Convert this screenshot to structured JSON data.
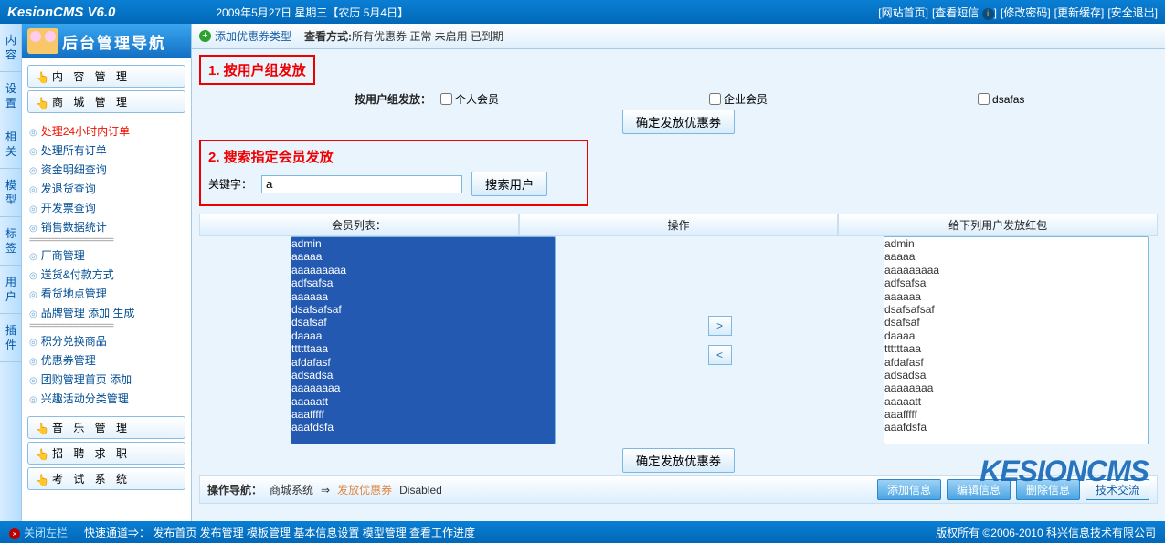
{
  "top": {
    "brand": "KesionCMS V6.0",
    "date": "2009年5月27日 星期三【农历 5月4日】",
    "links": {
      "home": "[网站首页]",
      "sms": "[查看短信",
      "sms2": "]",
      "pwd": "[修改密码]",
      "cache": "[更新缓存]",
      "exit": "[安全退出]"
    }
  },
  "rails": [
    "内容",
    "设置",
    "相关",
    "模型",
    "标签",
    "用户",
    "插件"
  ],
  "navhead": "后台管理导航",
  "navbtns": {
    "content": "内 容 管 理",
    "mall": "商 城 管 理",
    "music": "音 乐 管 理",
    "job": "招 聘 求 职",
    "exam": "考 试 系 统"
  },
  "navitems": [
    "处理24小时内订单",
    "处理所有订单",
    "资金明细查询",
    "发退货查询",
    "开发票查询",
    "销售数据统计"
  ],
  "navitems2": [
    "厂商管理",
    "送货&付款方式",
    "看货地点管理",
    "品牌管理 添加 生成"
  ],
  "navitems3": [
    "积分兑换商品",
    "优惠券管理",
    "团购管理首页 添加",
    "兴趣活动分类管理"
  ],
  "toolbar": {
    "add": "添加优惠券类型",
    "viewlabel": "查看方式:",
    "views": "所有优惠券 正常 未启用 已到期"
  },
  "annot1": "1. 按用户组发放",
  "annot2": "2. 搜索指定会员发放",
  "grouplabel": "按用户组发放：",
  "groups": {
    "g1": "个人会员",
    "g2": "企业会员",
    "g3": "dsafas"
  },
  "confirmBtn": "确定发放优惠券",
  "kwlabel": "关键字：",
  "kwvalue": "a",
  "searchBtn": "搜索用户",
  "colheads": {
    "left": "会员列表：",
    "mid": "操作",
    "right": "给下列用户发放红包"
  },
  "members": [
    "admin",
    "aaaaa",
    "aaaaaaaaa",
    "adfsafsa",
    "aaaaaa",
    "dsafsafsaf",
    "dsafsaf",
    "daaaa",
    "ttttttaaa",
    "afdafasf",
    "adsadsa",
    "aaaaaaaa",
    "aaaaatt",
    "aaafffff",
    "aaafdsfa"
  ],
  "ops": {
    "label": "操作导航：",
    "path": "商城系统",
    "arrow": " ⇒ ",
    "cur": "发放优惠券",
    "dis": " Disabled",
    "b1": "添加信息",
    "b2": "编辑信息",
    "b3": "删除信息",
    "b4": "技术交流"
  },
  "watermark": "KESIONCMS",
  "footer": {
    "close": "关闭左栏",
    "fast": "快速通道⇒： 发布首页 发布管理 模板管理 基本信息设置 模型管理 查看工作进度",
    "copy": "版权所有 ©2006-2010 科兴信息技术有限公司"
  }
}
